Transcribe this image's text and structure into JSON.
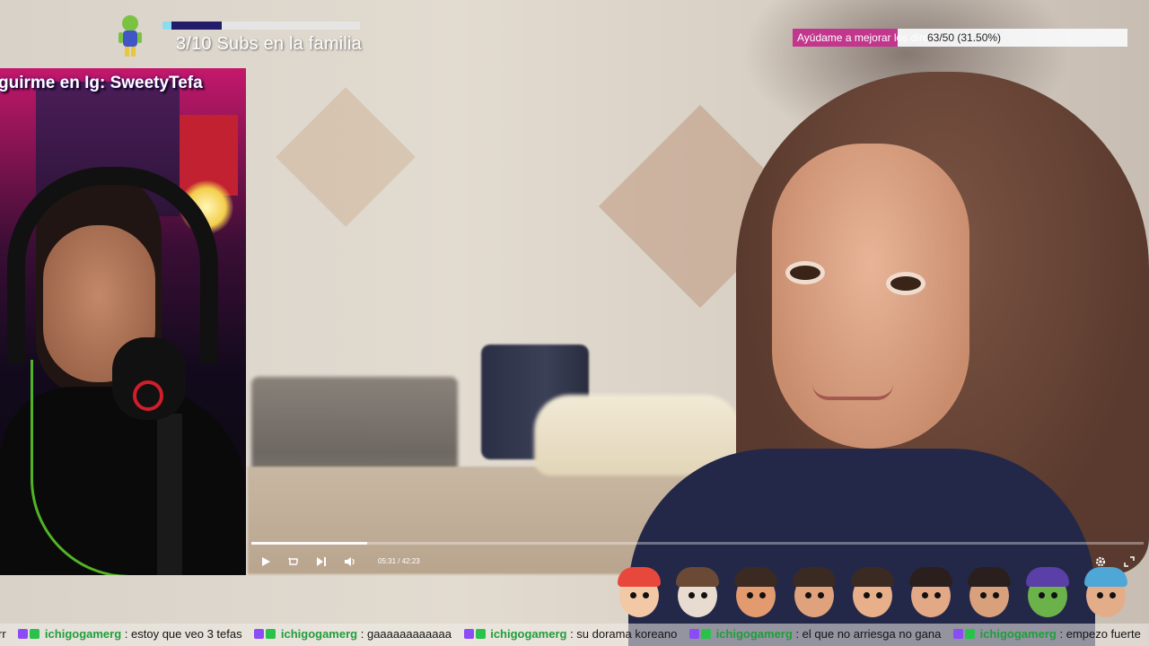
{
  "webcam": {
    "overlay_label": "guirme en Ig: SweetyTefa"
  },
  "sub_goal": {
    "text": "3/10 Subs en la familia",
    "current": 3,
    "target": 10,
    "colors": {
      "fill_light": "#8bdcf0",
      "fill_dark": "#231c68"
    }
  },
  "poll": {
    "label": "Ayúdame a mejorar los directos",
    "count_text": "63/50 (31.50%)",
    "fraction": 0.315,
    "color": "#c2368d"
  },
  "player": {
    "current_time": "05:31",
    "separator": "/",
    "duration": "42:23",
    "progress": 0.13,
    "icons": [
      "play-icon",
      "loop-icon",
      "skip-next-icon",
      "volume-icon",
      "settings-icon",
      "fullscreen-icon"
    ]
  },
  "emotes": [
    {
      "name": "clown-emote",
      "hair": "#e8473c",
      "skin": "#f3c9a5"
    },
    {
      "name": "monster-emote",
      "hair": "#6b4a35",
      "skin": "#e8dcd0"
    },
    {
      "name": "angry-fire-emote",
      "hair": "#3a2a22",
      "skin": "#e29a6e"
    },
    {
      "name": "heart-hug-emote",
      "hair": "#3a2a22",
      "skin": "#e0a27c"
    },
    {
      "name": "angel-emote",
      "hair": "#3a2a22",
      "skin": "#e7b08b"
    },
    {
      "name": "kiss-emote",
      "hair": "#2a1f1c",
      "skin": "#e3a886"
    },
    {
      "name": "gun-emote",
      "hair": "#2a1f1c",
      "skin": "#d9a07c"
    },
    {
      "name": "pepe-hood-emote",
      "hair": "#5a3fa8",
      "skin": "#6cb24a"
    },
    {
      "name": "sleep-emote",
      "hair": "#4fa7d8",
      "skin": "#e4ad8a"
    }
  ],
  "chat": {
    "colors": {
      "username": "#1f9e3a"
    },
    "messages": [
      {
        "user": "",
        "text": "rr"
      },
      {
        "user": "ichigogamerg",
        "text": ": estoy que veo 3 tefas"
      },
      {
        "user": "ichigogamerg",
        "text": ": gaaaaaaaaaaaa"
      },
      {
        "user": "ichigogamerg",
        "text": ": su dorama koreano"
      },
      {
        "user": "ichigogamerg",
        "text": ": el que no arriesga no gana"
      },
      {
        "user": "ichigogamerg",
        "text": ": empezo fuerte"
      }
    ]
  }
}
